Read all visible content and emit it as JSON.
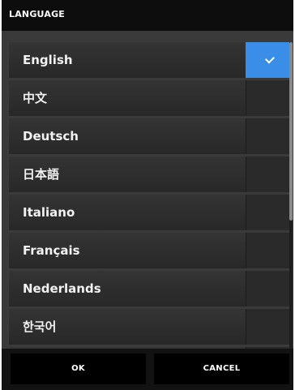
{
  "dialog": {
    "title": "LANGUAGE"
  },
  "languages": [
    {
      "label": "English",
      "selected": true
    },
    {
      "label": "中文",
      "selected": false
    },
    {
      "label": "Deutsch",
      "selected": false
    },
    {
      "label": "日本語",
      "selected": false
    },
    {
      "label": "Italiano",
      "selected": false
    },
    {
      "label": "Français",
      "selected": false
    },
    {
      "label": "Nederlands",
      "selected": false
    },
    {
      "label": "한국어",
      "selected": false
    },
    {
      "label": "",
      "selected": false
    }
  ],
  "buttons": {
    "ok_label": "OK",
    "cancel_label": "CANCEL"
  },
  "colors": {
    "accent": "#3a8ee8",
    "background": "#121212",
    "row": "#2f2f2f"
  },
  "icons": {
    "selected": "check-icon"
  }
}
